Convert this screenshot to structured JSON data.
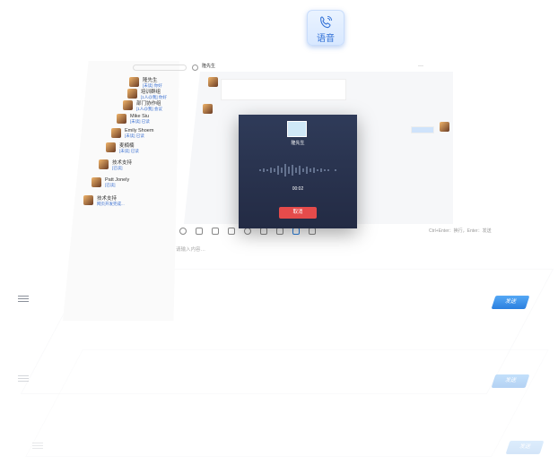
{
  "voice_badge": {
    "label": "语音"
  },
  "chat": {
    "peer_name": "隆先生",
    "placeholder": "请输入内容…",
    "shortcut_hint": "Ctrl+Enter：换行，Enter：发送"
  },
  "contacts": [
    {
      "name": "隆先生",
      "sub": "[未读] 你好"
    },
    {
      "name": "培训群组",
      "sub": "[1人@我] 你好"
    },
    {
      "name": "部门协作组",
      "sub": "[1人@我] 会议"
    },
    {
      "name": "Mike Siu",
      "sub": "[未读] 已读"
    },
    {
      "name": "Emily Shoem",
      "sub": "[未读] 已读"
    },
    {
      "name": "麦楠楠",
      "sub": "[未读] 已读"
    },
    {
      "name": "技术支持",
      "sub": "[已读]"
    },
    {
      "name": "Patt Jonely",
      "sub": "[已读]"
    },
    {
      "name": "技术支持",
      "sub": "网页开发完成..."
    }
  ],
  "call": {
    "name": "隆先生",
    "duration": "00:02",
    "cancel_label": "取消"
  },
  "send_label": "发送",
  "colors": {
    "accent": "#2b7fdf",
    "cancel": "#e54b4b",
    "call_bg": "#2a3550"
  }
}
